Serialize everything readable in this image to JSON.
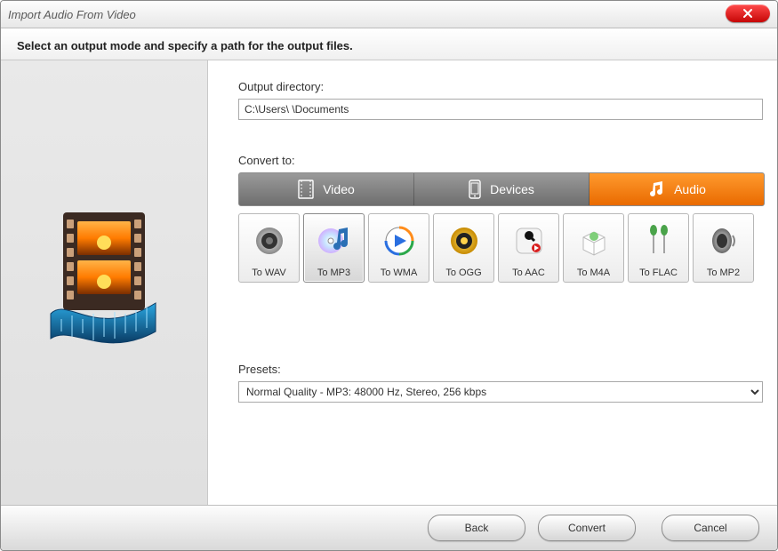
{
  "window": {
    "title": "Import Audio From Video"
  },
  "heading": "Select an output mode and specify a path for the output files.",
  "output": {
    "label": "Output directory:",
    "value": "C:\\Users\\        \\Documents"
  },
  "convert": {
    "label": "Convert to:",
    "tabs": [
      {
        "id": "video",
        "label": "Video",
        "active": false
      },
      {
        "id": "devices",
        "label": "Devices",
        "active": false
      },
      {
        "id": "audio",
        "label": "Audio",
        "active": true
      }
    ],
    "formats": [
      {
        "id": "wav",
        "label": "To WAV",
        "selected": false
      },
      {
        "id": "mp3",
        "label": "To MP3",
        "selected": true
      },
      {
        "id": "wma",
        "label": "To WMA",
        "selected": false
      },
      {
        "id": "ogg",
        "label": "To OGG",
        "selected": false
      },
      {
        "id": "aac",
        "label": "To AAC",
        "selected": false
      },
      {
        "id": "m4a",
        "label": "To M4A",
        "selected": false
      },
      {
        "id": "flac",
        "label": "To FLAC",
        "selected": false
      },
      {
        "id": "mp2",
        "label": "To MP2",
        "selected": false
      }
    ]
  },
  "presets": {
    "label": "Presets:",
    "selected": "Normal Quality - MP3: 48000 Hz, Stereo, 256 kbps"
  },
  "footer": {
    "back_label": "Back",
    "convert_label": "Convert",
    "cancel_label": "Cancel"
  },
  "colors": {
    "accent": "#f07c12",
    "close": "#d21010"
  }
}
